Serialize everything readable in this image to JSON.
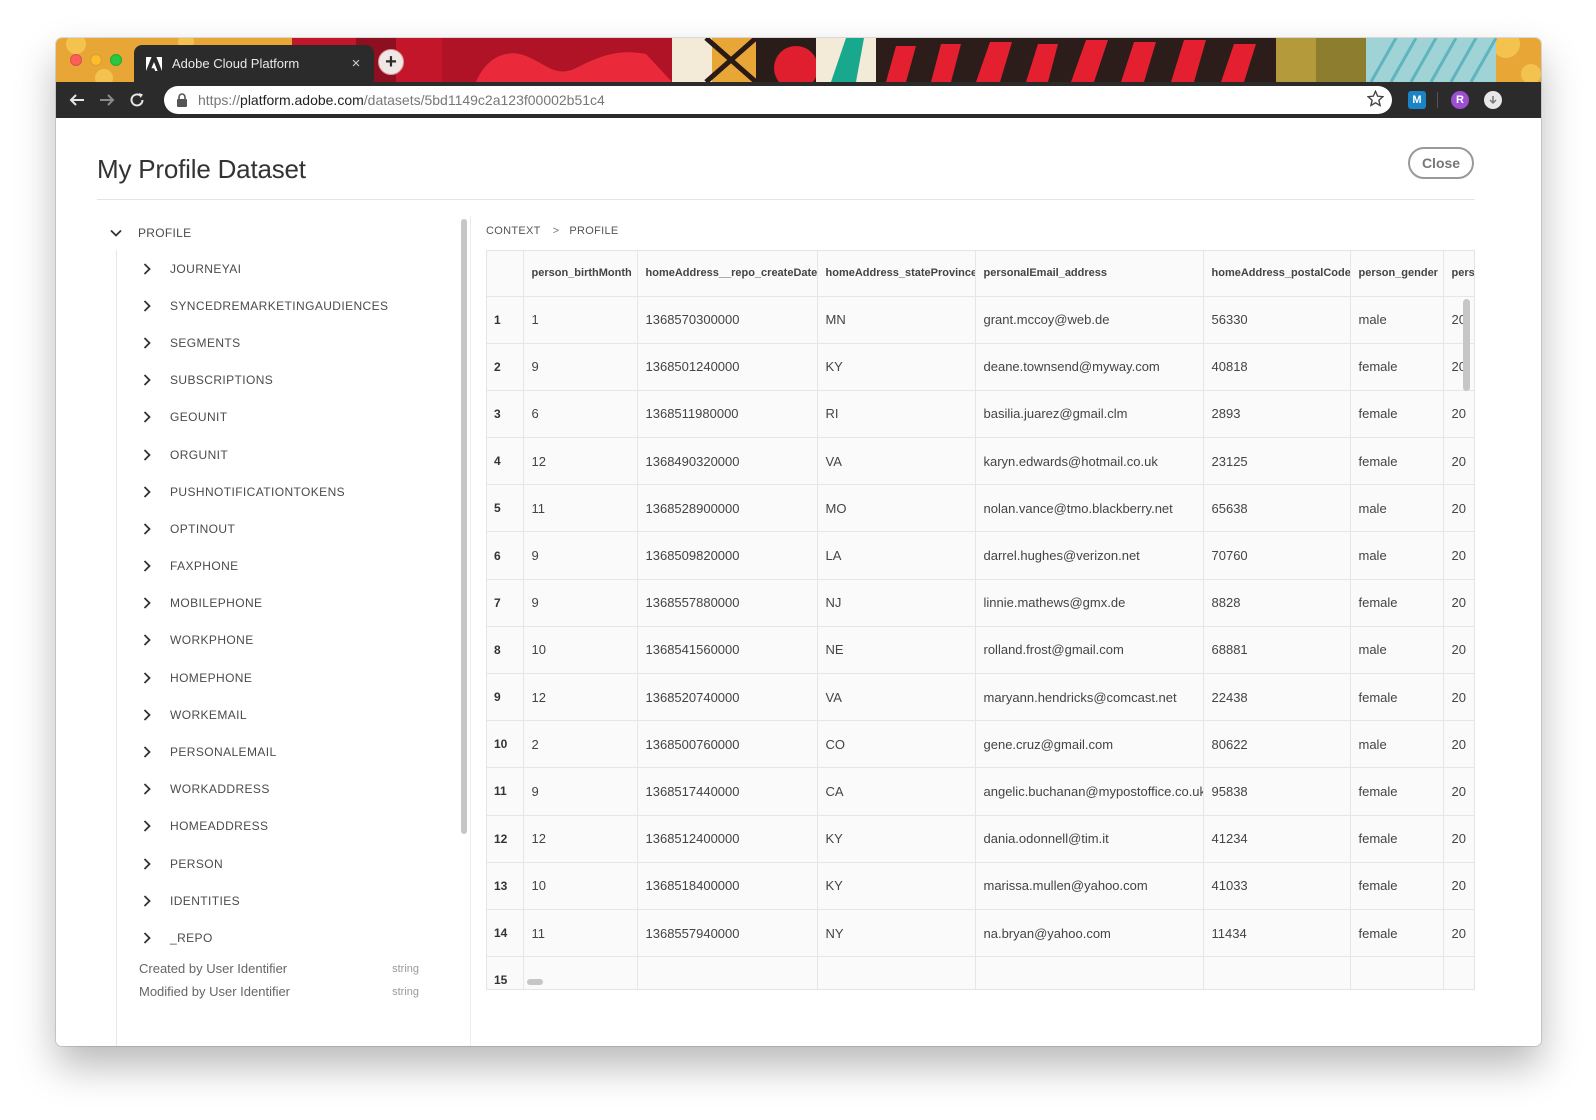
{
  "browser": {
    "tab_title": "Adobe Cloud Platform",
    "tab_close": "×",
    "new_tab": "+",
    "url_scheme": "https://",
    "url_host": "platform.adobe.com",
    "url_path": "/datasets/5bd1149c2a123f00002b51c4",
    "ext_m_label": "M",
    "ext_r_label": "R",
    "icons": [
      "back-arrow-icon",
      "forward-arrow-icon",
      "reload-icon",
      "lock-icon",
      "star-icon"
    ]
  },
  "page": {
    "title": "My Profile Dataset",
    "close_label": "Close"
  },
  "tree": {
    "root_label": "PROFILE",
    "items": [
      "JOURNEYAI",
      "SYNCEDREMARKETINGAUDIENCES",
      "SEGMENTS",
      "SUBSCRIPTIONS",
      "GEOUNIT",
      "ORGUNIT",
      "PUSHNOTIFICATIONTOKENS",
      "OPTINOUT",
      "FAXPHONE",
      "MOBILEPHONE",
      "WORKPHONE",
      "HOMEPHONE",
      "WORKEMAIL",
      "PERSONALEMAIL",
      "WORKADDRESS",
      "HOMEADDRESS",
      "PERSON",
      "IDENTITIES",
      "_REPO"
    ],
    "fields": [
      {
        "name": "Created by User Identifier",
        "type": "string"
      },
      {
        "name": "Modified by User Identifier",
        "type": "string"
      }
    ]
  },
  "breadcrumb": {
    "items": [
      "CONTEXT",
      "PROFILE"
    ],
    "separator": ">"
  },
  "table": {
    "columns": [
      "",
      "person_birthMonth",
      "homeAddress__repo_createDate",
      "homeAddress_stateProvince",
      "personalEmail_address",
      "homeAddress_postalCode",
      "person_gender",
      "perso"
    ],
    "rows": [
      [
        "1",
        "1",
        "1368570300000",
        "MN",
        "grant.mccoy@web.de",
        "56330",
        "male",
        "20"
      ],
      [
        "2",
        "9",
        "1368501240000",
        "KY",
        "deane.townsend@myway.com",
        "40818",
        "female",
        "20"
      ],
      [
        "3",
        "6",
        "1368511980000",
        "RI",
        "basilia.juarez@gmail.clm",
        "2893",
        "female",
        "20"
      ],
      [
        "4",
        "12",
        "1368490320000",
        "VA",
        "karyn.edwards@hotmail.co.uk",
        "23125",
        "female",
        "20"
      ],
      [
        "5",
        "11",
        "1368528900000",
        "MO",
        "nolan.vance@tmo.blackberry.net",
        "65638",
        "male",
        "20"
      ],
      [
        "6",
        "9",
        "1368509820000",
        "LA",
        "darrel.hughes@verizon.net",
        "70760",
        "male",
        "20"
      ],
      [
        "7",
        "9",
        "1368557880000",
        "NJ",
        "linnie.mathews@gmx.de",
        "8828",
        "female",
        "20"
      ],
      [
        "8",
        "10",
        "1368541560000",
        "NE",
        "rolland.frost@gmail.com",
        "68881",
        "male",
        "20"
      ],
      [
        "9",
        "12",
        "1368520740000",
        "VA",
        "maryann.hendricks@comcast.net",
        "22438",
        "female",
        "20"
      ],
      [
        "10",
        "2",
        "1368500760000",
        "CO",
        "gene.cruz@gmail.com",
        "80622",
        "male",
        "20"
      ],
      [
        "11",
        "9",
        "1368517440000",
        "CA",
        "angelic.buchanan@mypostoffice.co.uk",
        "95838",
        "female",
        "20"
      ],
      [
        "12",
        "12",
        "1368512400000",
        "KY",
        "dania.odonnell@tim.it",
        "41234",
        "female",
        "20"
      ],
      [
        "13",
        "10",
        "1368518400000",
        "KY",
        "marissa.mullen@yahoo.com",
        "41033",
        "female",
        "20"
      ],
      [
        "14",
        "11",
        "1368557940000",
        "NY",
        "na.bryan@yahoo.com",
        "11434",
        "female",
        "20"
      ],
      [
        "15",
        "",
        "",
        "",
        "",
        "",
        "",
        ""
      ]
    ]
  },
  "colors": {
    "toolbar": "#2b2b2b",
    "adobe_red": "#eb1000",
    "text": "#444444"
  }
}
